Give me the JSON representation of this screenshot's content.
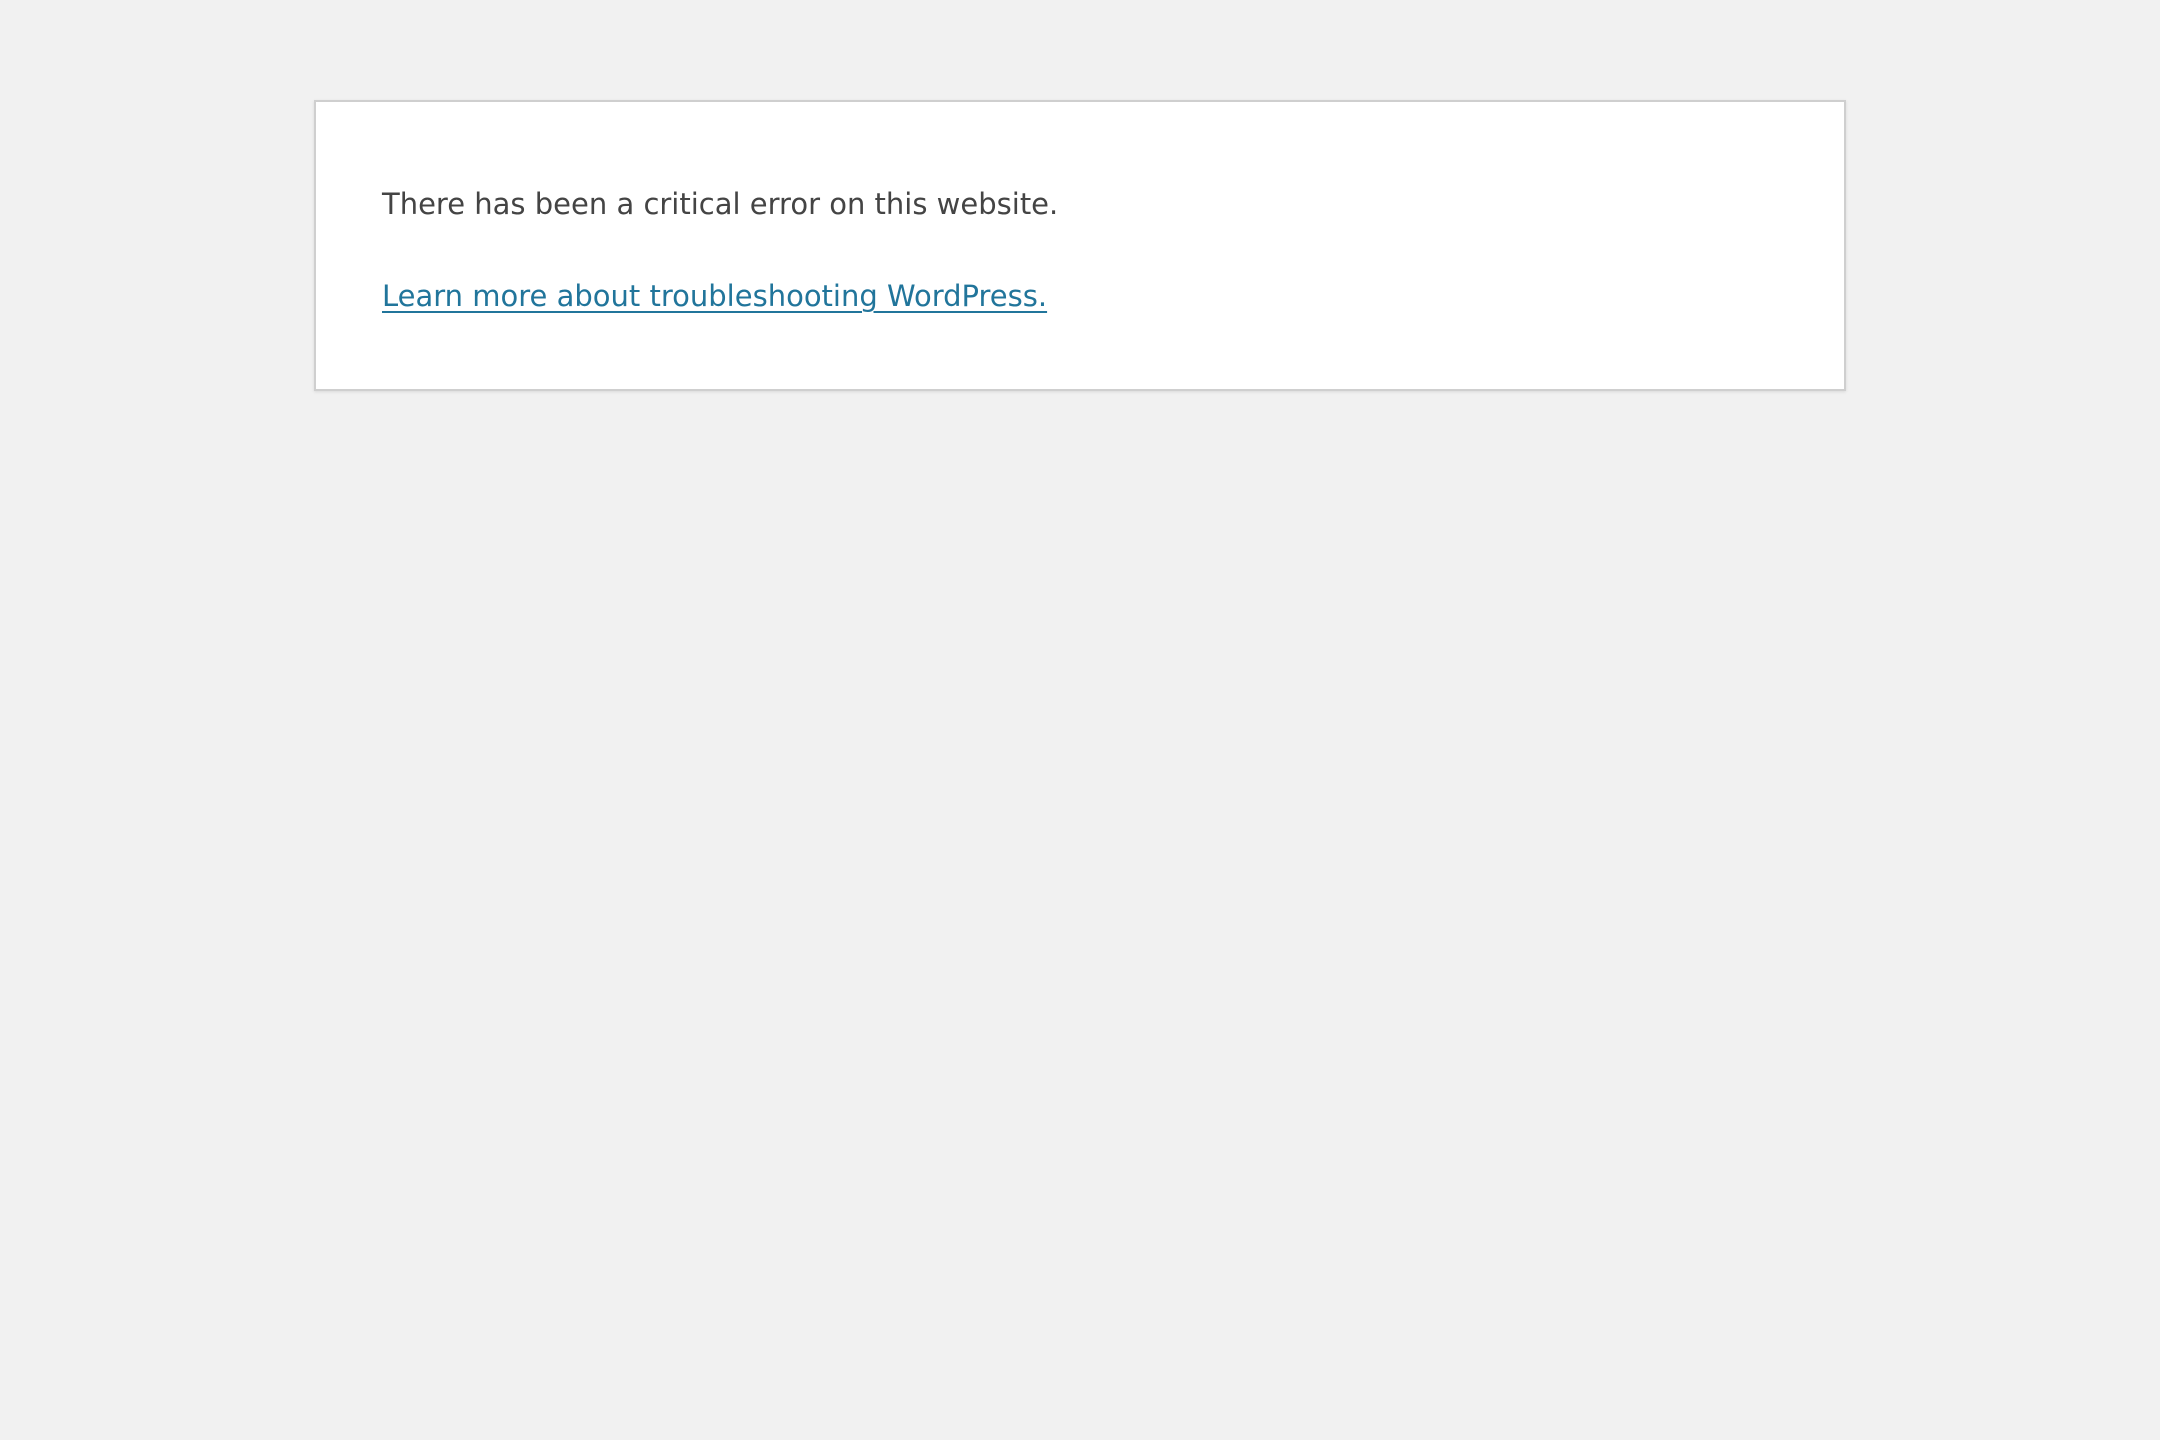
{
  "error": {
    "message": "There has been a critical error on this website.",
    "link_text": "Learn more about troubleshooting WordPress."
  },
  "colors": {
    "background": "#f1f1f1",
    "card": "#ffffff",
    "text": "#444444",
    "link": "#21759b",
    "border": "#cfcfcf"
  }
}
